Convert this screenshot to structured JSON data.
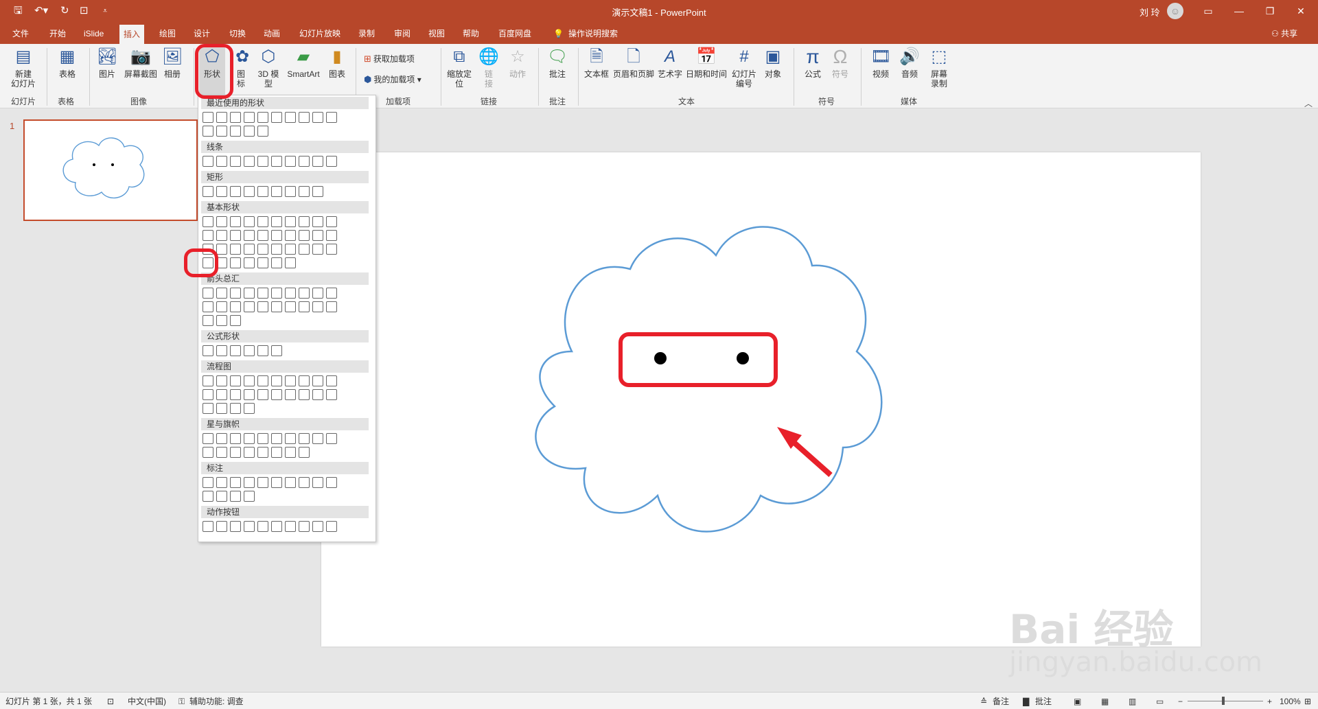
{
  "window": {
    "title": "演示文稿1 - PowerPoint",
    "user": "刘 玲"
  },
  "tabs": [
    "文件",
    "开始",
    "iSlide",
    "插入",
    "绘图",
    "设计",
    "切换",
    "动画",
    "幻灯片放映",
    "录制",
    "审阅",
    "视图",
    "帮助",
    "百度网盘",
    "操作说明搜索"
  ],
  "share_label": "共享",
  "ribbon": {
    "new_slide": "新建\n幻灯片",
    "table": "表格",
    "pictures": "图片",
    "screenshot": "屏幕截图",
    "album": "相册",
    "shapes": "形状",
    "icons": "图\n标",
    "model3d": "3D 模\n型",
    "smartart": "SmartArt",
    "chart": "图表",
    "get_addins": "获取加载项",
    "my_addins": "我的加载项",
    "zoom": "缩放定\n位",
    "link": "链\n接",
    "action": "动作",
    "comment": "批注",
    "textbox": "文本框",
    "header_footer": "页眉和页脚",
    "wordart": "艺术字",
    "datetime": "日期和时间",
    "slide_number": "幻灯片\n编号",
    "object": "对象",
    "equation": "公式",
    "symbol": "符号",
    "video": "视频",
    "audio": "音频",
    "screen_record": "屏幕\n录制",
    "groups": {
      "slides": "幻灯片",
      "tables": "表格",
      "images": "图像",
      "addins": "加载项",
      "links": "链接",
      "comments": "批注",
      "text": "文本",
      "symbols": "符号",
      "media": "媒体"
    }
  },
  "shapes_menu": {
    "categories": [
      "最近使用的形状",
      "线条",
      "矩形",
      "基本形状",
      "箭头总汇",
      "公式形状",
      "流程图",
      "星与旗帜",
      "标注",
      "动作按钮"
    ]
  },
  "slide_panel": {
    "number": "1"
  },
  "statusbar": {
    "slide_info": "幻灯片 第 1 张，共 1 张",
    "language": "中文(中国)",
    "accessibility": "辅助功能: 调查",
    "notes": "备注",
    "comments": "批注",
    "zoom": "100%"
  },
  "watermark": {
    "brand": "Bai  经验",
    "url": "jingyan.baidu.com"
  },
  "colors": {
    "accent": "#b7472a",
    "cloud_stroke": "#5b9bd5",
    "highlight": "#e8202a"
  }
}
